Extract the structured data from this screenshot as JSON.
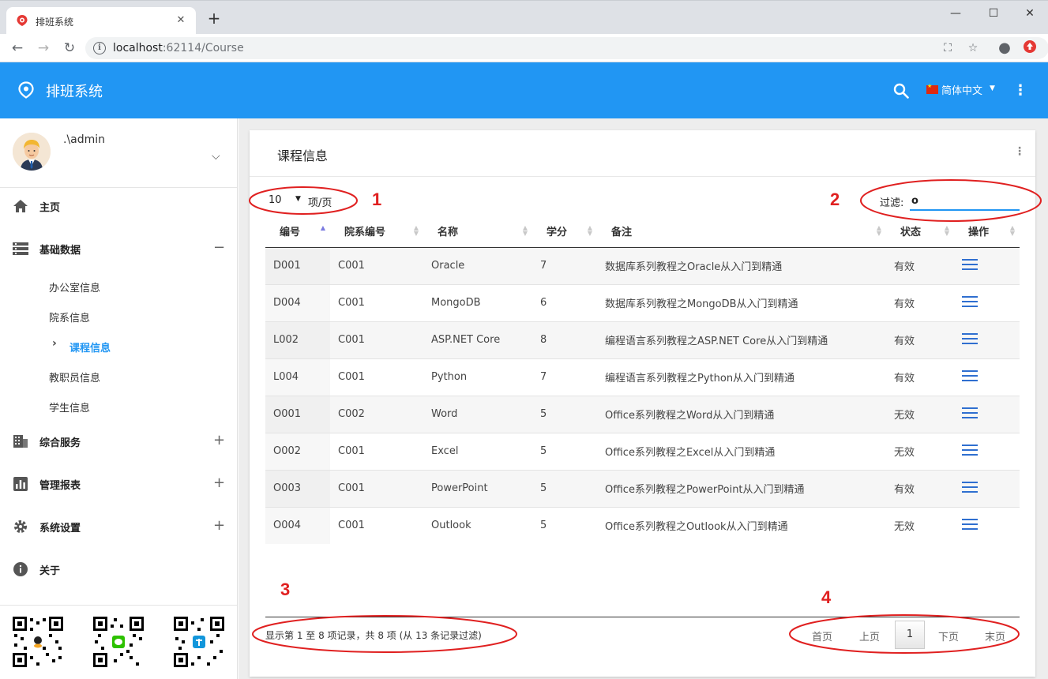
{
  "browser": {
    "tab_title": "排班系统",
    "new_tab": "+",
    "url_host": "localhost",
    "url_path": ":62114/Course"
  },
  "app": {
    "brand": "排班系统",
    "language": "简体中文",
    "primary_color": "#2196f3"
  },
  "user": {
    "name": ".\\admin"
  },
  "sidebar": {
    "items": [
      {
        "label": "主页",
        "icon": "home-icon"
      },
      {
        "label": "基础数据",
        "icon": "list-icon",
        "toggle": "−"
      },
      {
        "label": "综合服务",
        "icon": "building-icon",
        "toggle": "+"
      },
      {
        "label": "管理报表",
        "icon": "chart-icon",
        "toggle": "+"
      },
      {
        "label": "系统设置",
        "icon": "gear-icon",
        "toggle": "+"
      },
      {
        "label": "关于",
        "icon": "info-icon"
      }
    ],
    "subitems": [
      "办公室信息",
      "院系信息",
      "课程信息",
      "教职员信息",
      "学生信息"
    ]
  },
  "card": {
    "title": "课程信息"
  },
  "table_controls": {
    "page_size": "10",
    "page_size_label": "项/页",
    "filter_label": "过滤:",
    "filter_value": "o"
  },
  "table": {
    "headers": [
      "编号",
      "院系编号",
      "名称",
      "学分",
      "备注",
      "状态",
      "操作"
    ],
    "rows": [
      [
        "D001",
        "C001",
        "Oracle",
        "7",
        "数据库系列教程之Oracle从入门到精通",
        "有效"
      ],
      [
        "D004",
        "C001",
        "MongoDB",
        "6",
        "数据库系列教程之MongoDB从入门到精通",
        "有效"
      ],
      [
        "L002",
        "C001",
        "ASP.NET Core",
        "8",
        "编程语言系列教程之ASP.NET Core从入门到精通",
        "有效"
      ],
      [
        "L004",
        "C001",
        "Python",
        "7",
        "编程语言系列教程之Python从入门到精通",
        "有效"
      ],
      [
        "O001",
        "C002",
        "Word",
        "5",
        "Office系列教程之Word从入门到精通",
        "无效"
      ],
      [
        "O002",
        "C001",
        "Excel",
        "5",
        "Office系列教程之Excel从入门到精通",
        "无效"
      ],
      [
        "O003",
        "C001",
        "PowerPoint",
        "5",
        "Office系列教程之PowerPoint从入门到精通",
        "有效"
      ],
      [
        "O004",
        "C001",
        "Outlook",
        "5",
        "Office系列教程之Outlook从入门到精通",
        "无效"
      ]
    ]
  },
  "footer": {
    "info": "显示第 1 至 8 项记录，共 8 项 (从 13 条记录过滤)",
    "pager": {
      "first": "首页",
      "prev": "上页",
      "current": "1",
      "next": "下页",
      "last": "末页"
    }
  },
  "annotations": {
    "marks": [
      "1",
      "2",
      "3",
      "4"
    ],
    "color": "#e02020"
  }
}
